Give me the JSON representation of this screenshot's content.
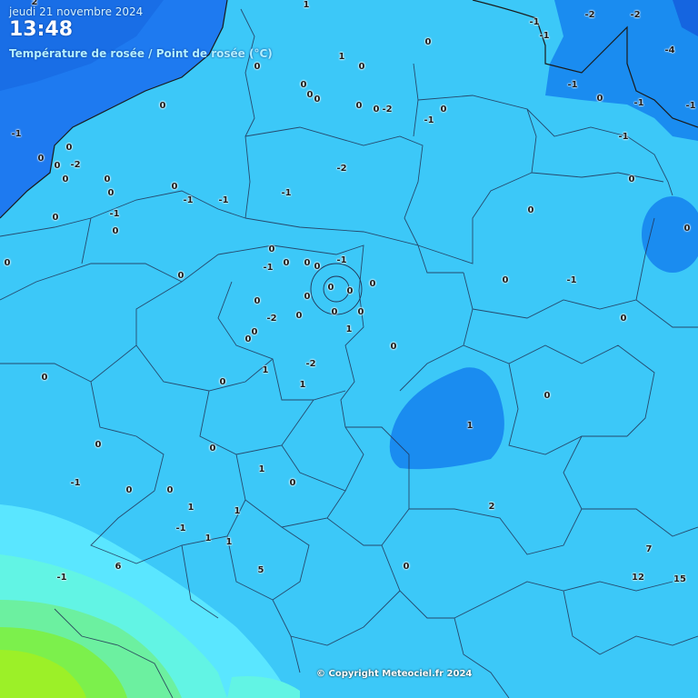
{
  "header": {
    "date": "jeudi 21 novembre 2024",
    "time": "13:48",
    "subtitle": "Température de rosée / Point de rosée (°C)"
  },
  "copyright": "© Copyright Meteociel.fr 2024",
  "colors": {
    "sea": "#1e7af0",
    "deep_sea": "#1565e0",
    "zone_0": "#3cc8f8",
    "zone_neg2": "#1a8cf0",
    "zone_1": "#5ae6ff",
    "zone_2": "#62f4e4",
    "zone_3": "#6cf0a0",
    "zone_5": "#7cf04c",
    "zone_7": "#9cf028"
  },
  "station_values": [
    "2",
    "1",
    "-2",
    "-2",
    "-1",
    "-1",
    "-4",
    "0",
    "1",
    "0",
    "0",
    "-1",
    "0",
    "0",
    "0",
    "0",
    "-2",
    "0",
    "0",
    "0",
    "0",
    "-1",
    "-1",
    "0",
    "-1",
    "0",
    "0",
    "0",
    "-1",
    "0",
    "-1",
    "-1",
    "0",
    "-1",
    "0",
    "0",
    "0",
    "-2",
    "0",
    "-1",
    "-2",
    "-1",
    "0",
    "0",
    "0",
    "0",
    "-1",
    "0",
    "0",
    "-1",
    "0",
    "0",
    "0",
    "-1",
    "0",
    "0",
    "0",
    "0",
    "0",
    "0",
    "0",
    "-2",
    "0",
    "0",
    "0",
    "0",
    "1",
    "0",
    "-2",
    "1",
    "0",
    "1",
    "0",
    "0",
    "1",
    "0",
    "0",
    "1",
    "0",
    "-1",
    "0",
    "0",
    "1",
    "1",
    "2",
    "-1",
    "1",
    "1",
    "5",
    "7",
    "6",
    "0",
    "12",
    "15",
    "-1"
  ]
}
